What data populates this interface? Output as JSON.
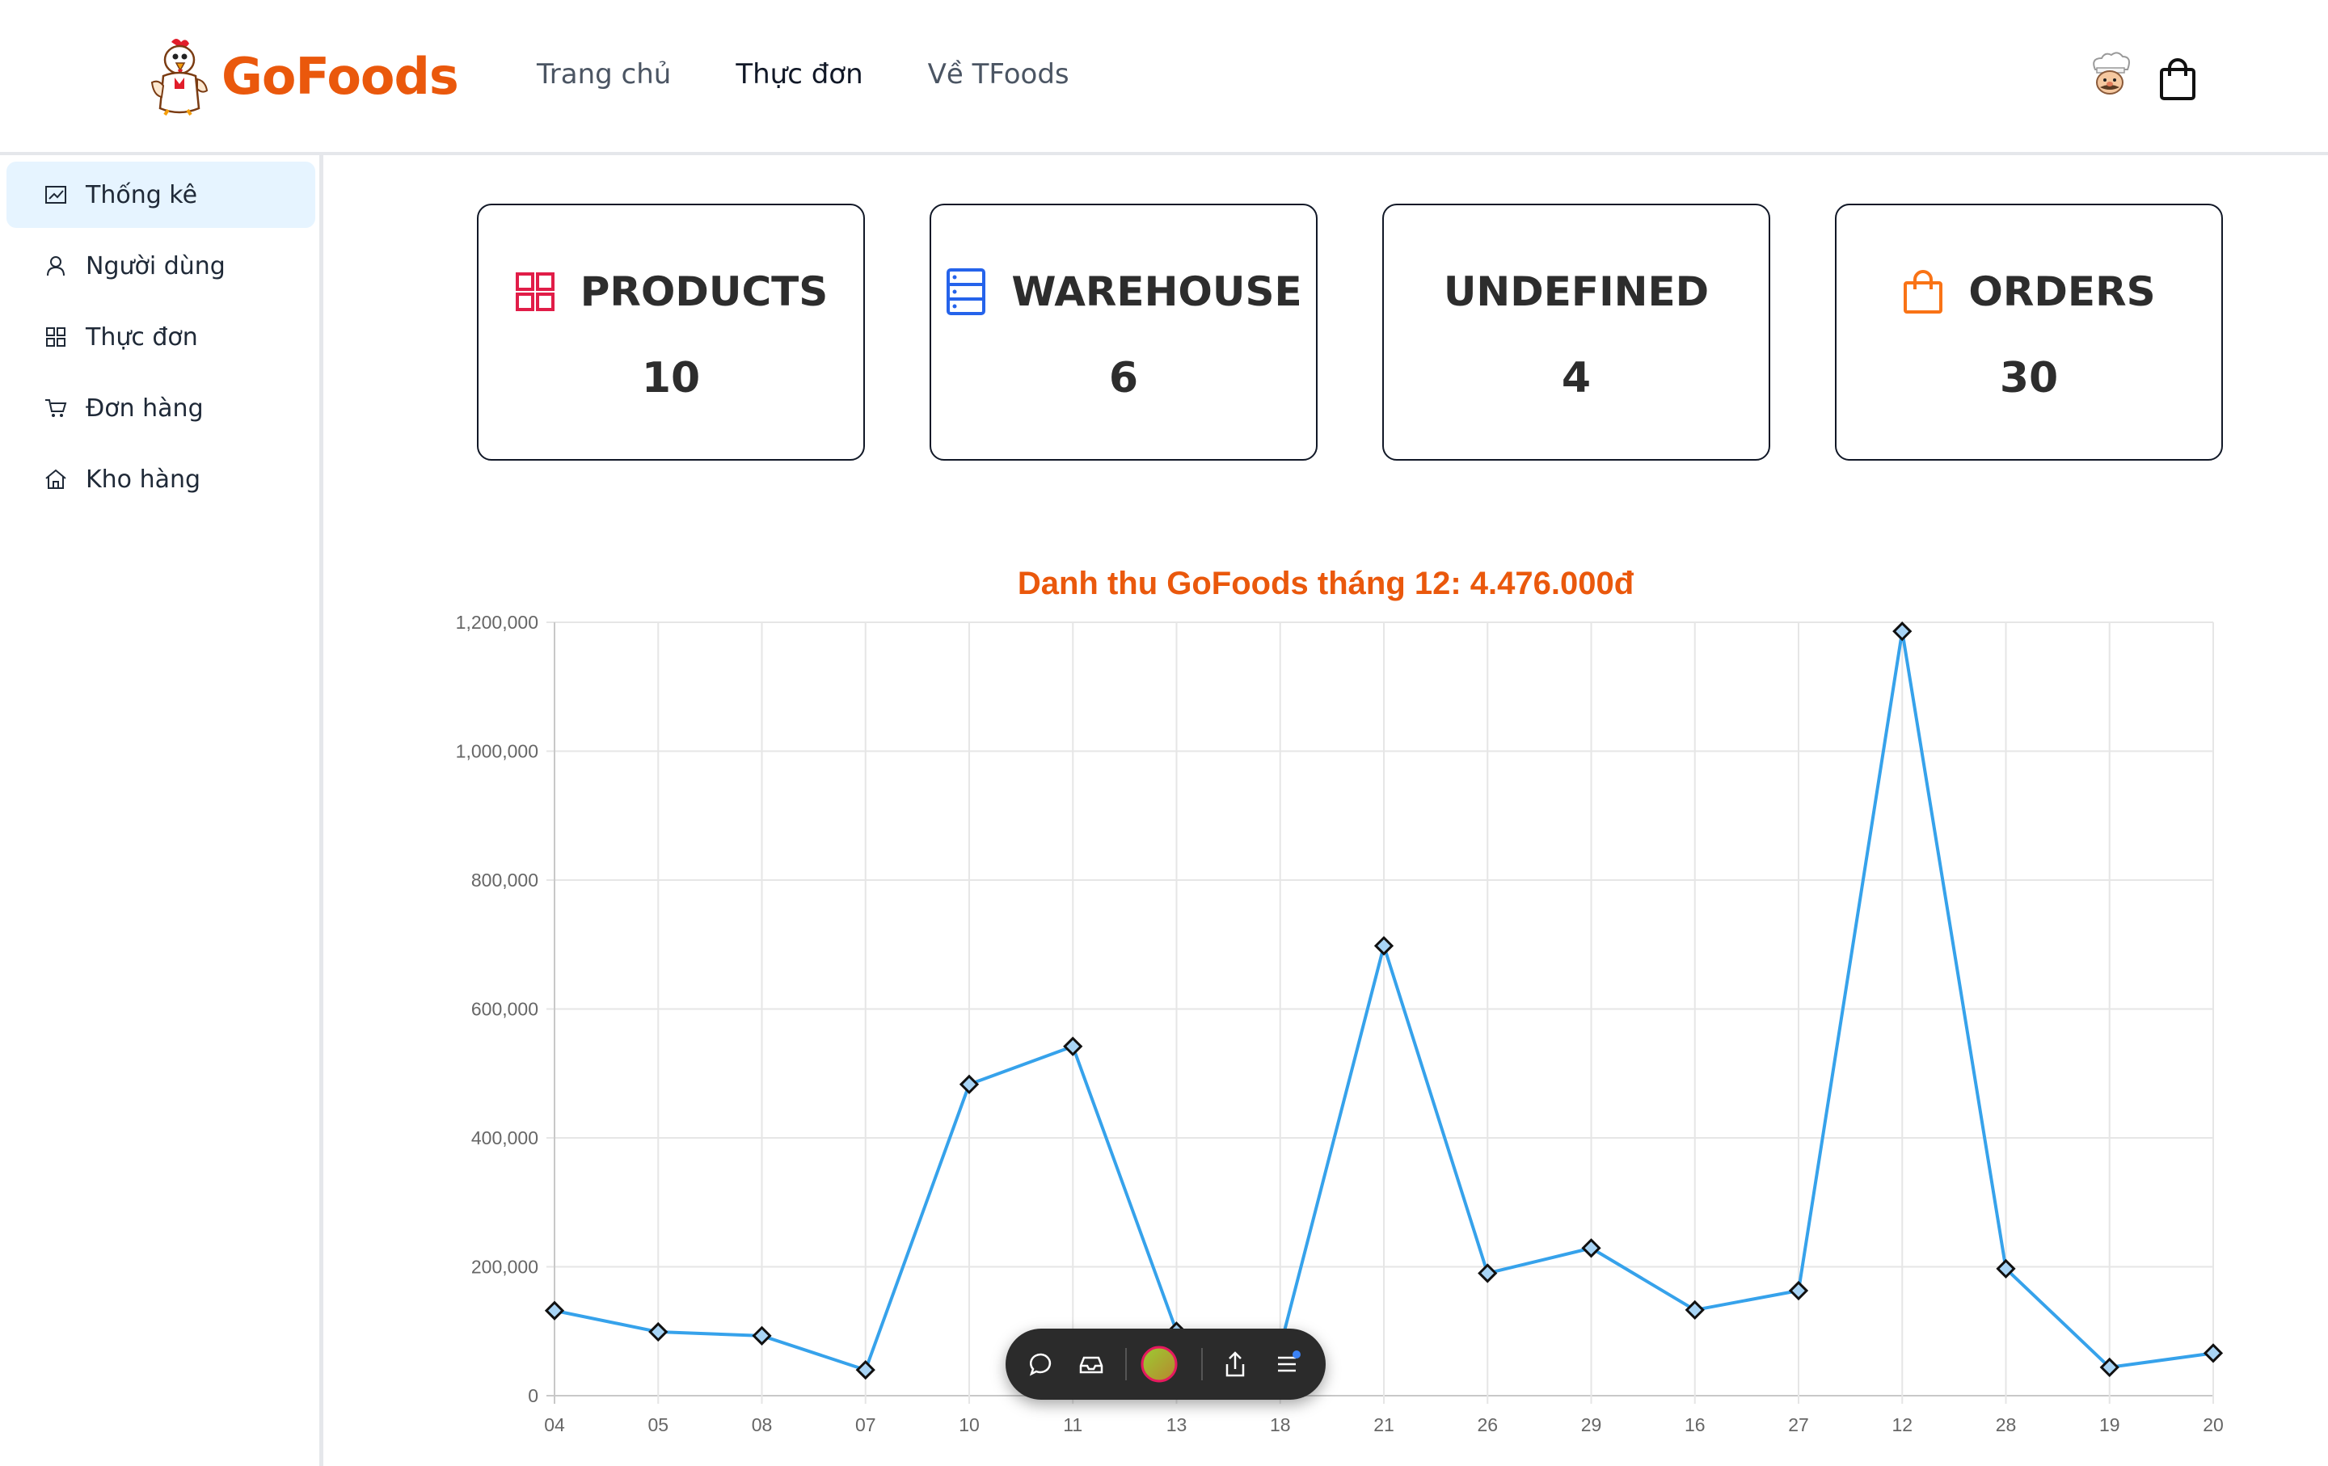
{
  "brand": {
    "name": "GoFoods",
    "color": "#ea580c"
  },
  "nav": {
    "items": [
      {
        "label": "Trang chủ",
        "active": false
      },
      {
        "label": "Thực đơn",
        "active": true
      },
      {
        "label": "Về TFoods",
        "active": false
      }
    ]
  },
  "header_icons": [
    "chef-avatar",
    "shopping-bag-icon"
  ],
  "sidebar": {
    "items": [
      {
        "label": "Thống kê",
        "icon": "line-chart-icon",
        "active": true
      },
      {
        "label": "Người dùng",
        "icon": "user-icon",
        "active": false
      },
      {
        "label": "Thực đơn",
        "icon": "grid-icon",
        "active": false
      },
      {
        "label": "Đơn hàng",
        "icon": "cart-icon",
        "active": false
      },
      {
        "label": "Kho hàng",
        "icon": "home-icon",
        "active": false
      }
    ]
  },
  "stats": [
    {
      "title": "PRODUCTS",
      "value": "10",
      "icon": "grid-icon",
      "color": "#e11d48"
    },
    {
      "title": "WAREHOUSE",
      "value": "6",
      "icon": "server-icon",
      "color": "#2563eb"
    },
    {
      "title": "UNDEFINED",
      "value": "4",
      "icon": "",
      "color": ""
    },
    {
      "title": "ORDERS",
      "value": "30",
      "icon": "shopping-bag-icon",
      "color": "#f97316"
    }
  ],
  "chart_data": {
    "type": "line",
    "title": "Danh thu GoFoods tháng 12: 4.476.000đ",
    "categories": [
      "04",
      "05",
      "08",
      "07",
      "10",
      "11",
      "13",
      "18",
      "21",
      "26",
      "29",
      "16",
      "27",
      "12",
      "28",
      "19",
      "20"
    ],
    "series": [
      {
        "values": [
          132000,
          99000,
          93000,
          40000,
          483000,
          542000,
          100000,
          75000,
          698000,
          190000,
          229000,
          133000,
          163000,
          1186000,
          197000,
          44000,
          66000
        ],
        "color": "#36a2eb"
      }
    ],
    "ylim": [
      0,
      1200000
    ],
    "yticks": [
      "0",
      "200,000",
      "400,000",
      "600,000",
      "800,000",
      "1,000,000",
      "1,200,000"
    ],
    "grid": true,
    "legend": "none",
    "marker": "diamond"
  },
  "toolbar": {
    "icons": [
      "chat-icon",
      "inbox-icon",
      "profile-avatar",
      "share-icon",
      "menu-icon"
    ]
  }
}
